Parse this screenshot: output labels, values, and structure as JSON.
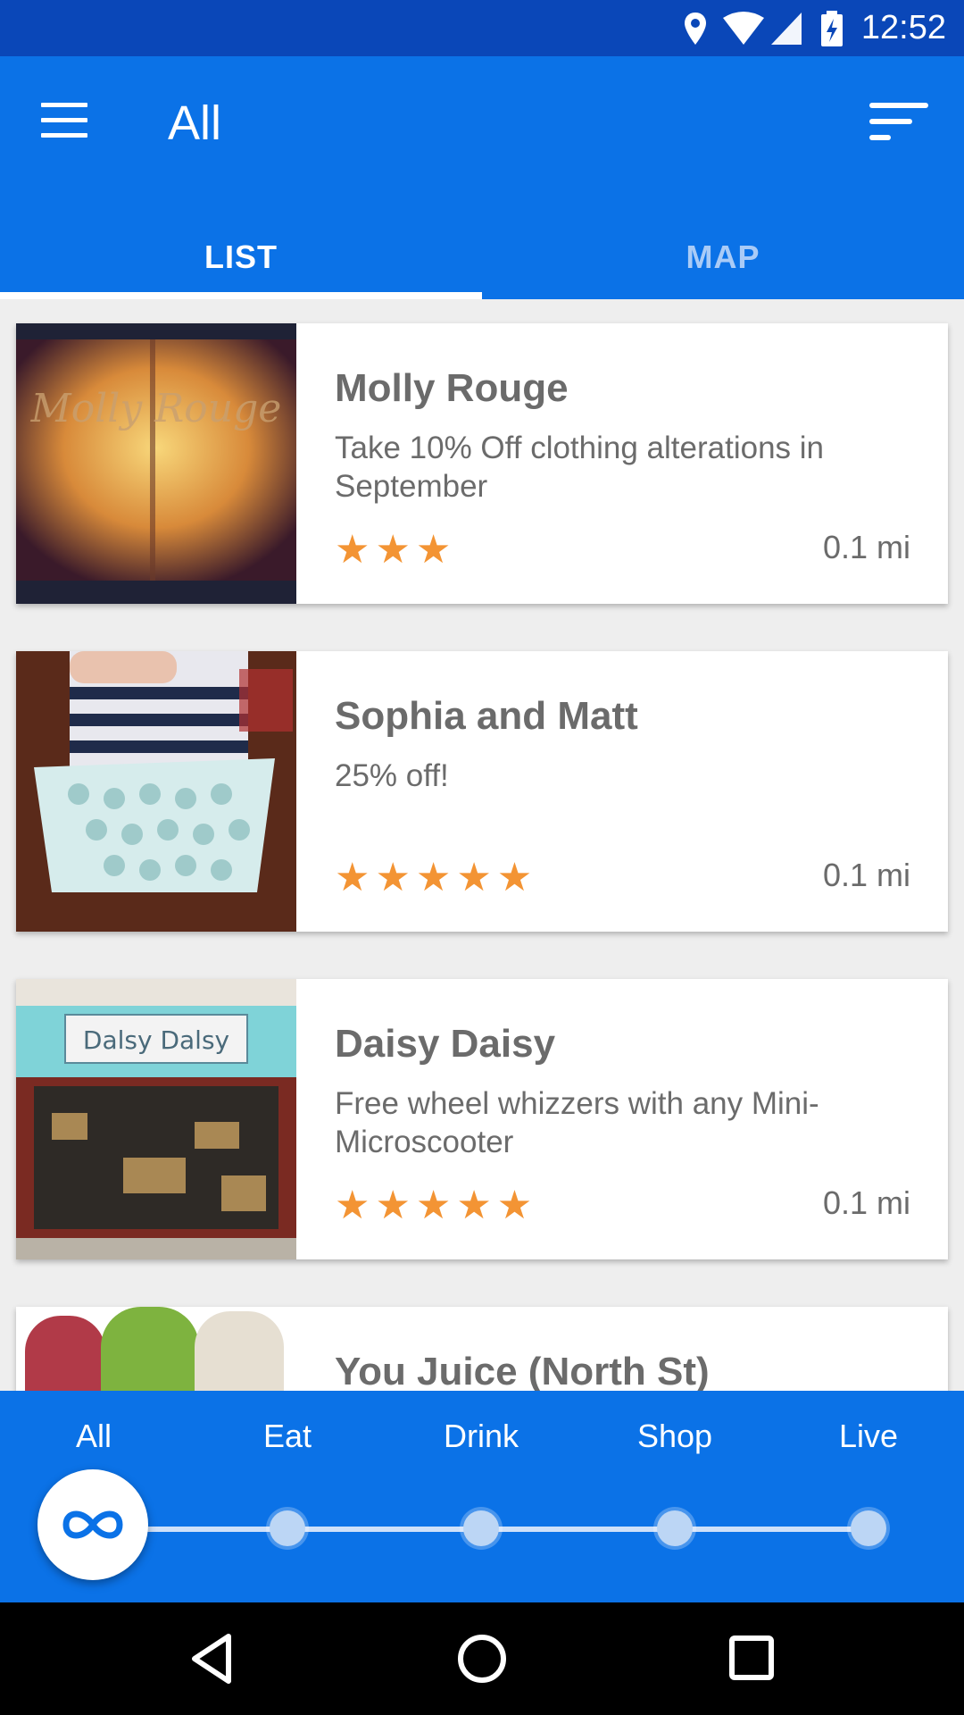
{
  "status_bar": {
    "time": "12:52",
    "icons": [
      "location-icon",
      "wifi-icon",
      "signal-icon",
      "battery-charging-icon"
    ]
  },
  "app_bar": {
    "title": "All",
    "menu_icon": "hamburger-menu-icon",
    "filter_icon": "sort-filter-icon"
  },
  "tabs": [
    {
      "label": "LIST",
      "selected": true
    },
    {
      "label": "MAP",
      "selected": false
    }
  ],
  "listings": [
    {
      "name": "Molly Rouge",
      "offer": "Take 10% Off clothing alterations in September",
      "rating": 3,
      "stars": "★★★",
      "distance": "0.1 mi",
      "image_text": "Molly Rouge"
    },
    {
      "name": "Sophia and Matt",
      "offer": "25% off!",
      "rating": 5,
      "stars": "★★★★★",
      "distance": "0.1 mi"
    },
    {
      "name": "Daisy Daisy",
      "offer": "Free wheel whizzers with any Mini-Microscooter",
      "rating": 5,
      "stars": "★★★★★",
      "distance": "0.1 mi",
      "image_text": "Dalsy Dalsy"
    },
    {
      "name": "You Juice (North St)",
      "offer": "",
      "distance": ""
    }
  ],
  "categories": {
    "labels": [
      "All",
      "Eat",
      "Drink",
      "Shop",
      "Live"
    ],
    "selected": "All",
    "selected_icon": "infinity-icon"
  },
  "nav_bar": {
    "icons": [
      "back-icon",
      "home-icon",
      "recents-icon"
    ]
  },
  "colors": {
    "primary": "#0b72e7",
    "status_bar": "#0a47b8",
    "star": "#f39434",
    "text": "#6b6b6b"
  }
}
